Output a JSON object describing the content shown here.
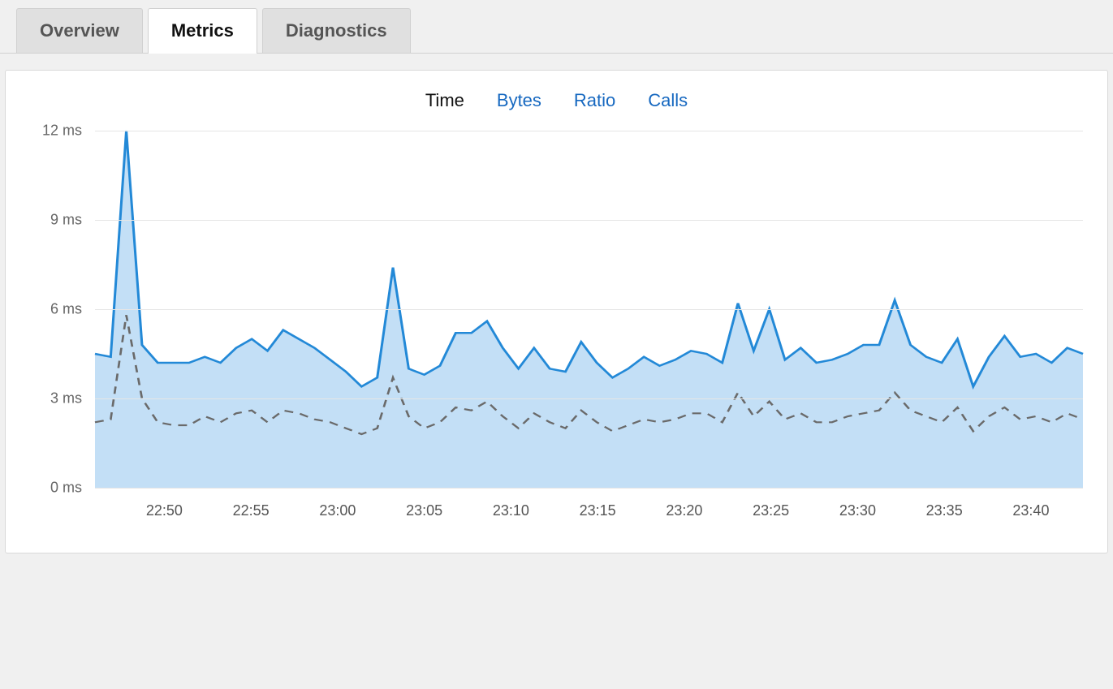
{
  "tabs": {
    "overview": "Overview",
    "metrics": "Metrics",
    "diagnostics": "Diagnostics",
    "active": "metrics"
  },
  "sub_tabs": {
    "time": "Time",
    "bytes": "Bytes",
    "ratio": "Ratio",
    "calls": "Calls",
    "active": "time"
  },
  "chart_data": {
    "type": "line",
    "xlabel": "",
    "ylabel": "",
    "ylim": [
      0,
      12
    ],
    "y_ticks": [
      "0 ms",
      "3 ms",
      "6 ms",
      "9 ms",
      "12 ms"
    ],
    "x_ticks": [
      "22:50",
      "22:55",
      "23:00",
      "23:05",
      "23:10",
      "23:15",
      "23:20",
      "23:25",
      "23:30",
      "23:35",
      "23:40"
    ],
    "x_start_minute": 46,
    "x_end_minute": 103,
    "series": [
      {
        "name": "primary-ms",
        "style": "area-line",
        "color": "#2389d7",
        "values": [
          4.5,
          4.4,
          12.0,
          4.8,
          4.2,
          4.2,
          4.2,
          4.4,
          4.2,
          4.7,
          5.0,
          4.6,
          5.3,
          5.0,
          4.7,
          4.3,
          3.9,
          3.4,
          3.7,
          7.4,
          4.0,
          3.8,
          4.1,
          5.2,
          5.2,
          5.6,
          4.7,
          4.0,
          4.7,
          4.0,
          3.9,
          4.9,
          4.2,
          3.7,
          4.0,
          4.4,
          4.1,
          4.3,
          4.6,
          4.5,
          4.2,
          6.2,
          4.6,
          6.0,
          4.3,
          4.7,
          4.2,
          4.3,
          4.5,
          4.8,
          4.8,
          6.3,
          4.8,
          4.4,
          4.2,
          5.0,
          3.4,
          4.4,
          5.1,
          4.4,
          4.5,
          4.2,
          4.7,
          4.5
        ]
      },
      {
        "name": "secondary-ms",
        "style": "dashed",
        "color": "#6a6a6a",
        "values": [
          2.2,
          2.3,
          5.8,
          3.0,
          2.2,
          2.1,
          2.1,
          2.4,
          2.2,
          2.5,
          2.6,
          2.2,
          2.6,
          2.5,
          2.3,
          2.2,
          2.0,
          1.8,
          2.0,
          3.7,
          2.4,
          2.0,
          2.2,
          2.7,
          2.6,
          2.9,
          2.4,
          2.0,
          2.5,
          2.2,
          2.0,
          2.6,
          2.2,
          1.9,
          2.1,
          2.3,
          2.2,
          2.3,
          2.5,
          2.5,
          2.2,
          3.2,
          2.4,
          2.9,
          2.3,
          2.5,
          2.2,
          2.2,
          2.4,
          2.5,
          2.6,
          3.2,
          2.6,
          2.4,
          2.2,
          2.7,
          1.9,
          2.4,
          2.7,
          2.3,
          2.4,
          2.2,
          2.5,
          2.3
        ]
      }
    ]
  }
}
